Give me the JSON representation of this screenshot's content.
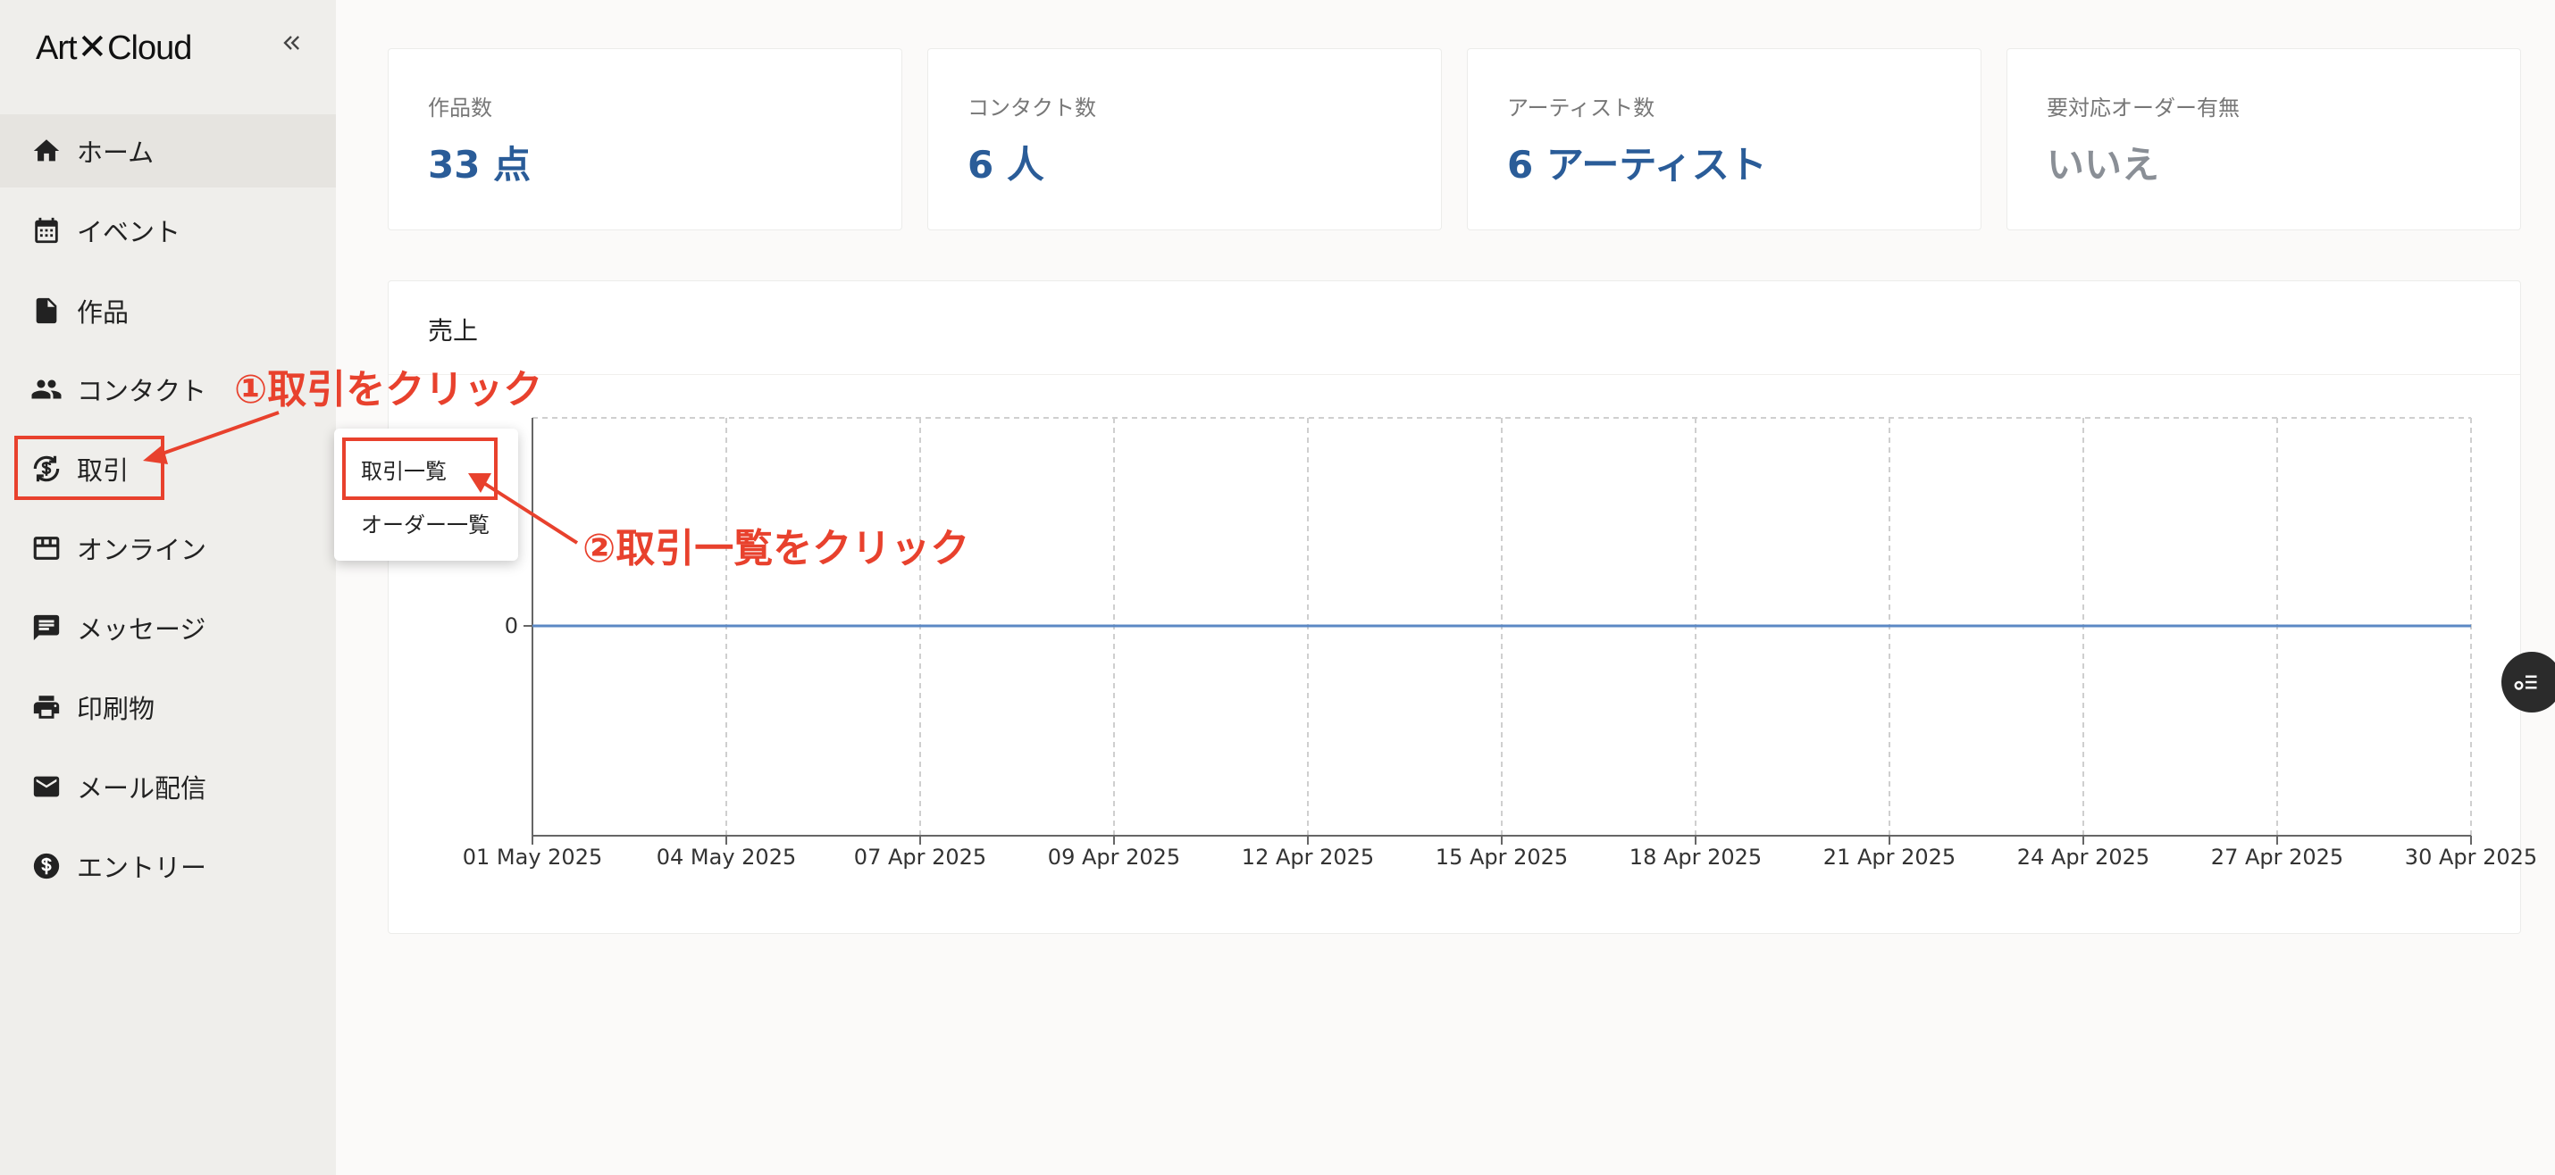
{
  "app": {
    "logo_left": "Art",
    "logo_x": "✕",
    "logo_right": "Cloud"
  },
  "sidebar": {
    "items": [
      {
        "label": "ホーム",
        "icon": "home-icon",
        "active": true
      },
      {
        "label": "イベント",
        "icon": "calendar-icon"
      },
      {
        "label": "作品",
        "icon": "document-icon"
      },
      {
        "label": "コンタクト",
        "icon": "people-icon"
      },
      {
        "label": "取引",
        "icon": "currency-exchange-icon"
      },
      {
        "label": "オンライン",
        "icon": "store-icon"
      },
      {
        "label": "メッセージ",
        "icon": "message-icon"
      },
      {
        "label": "印刷物",
        "icon": "printer-icon"
      },
      {
        "label": "メール配信",
        "icon": "mail-icon"
      },
      {
        "label": "エントリー",
        "icon": "dollar-circle-icon"
      }
    ]
  },
  "stats": [
    {
      "label": "作品数",
      "value": "33 点"
    },
    {
      "label": "コンタクト数",
      "value": "6 人"
    },
    {
      "label": "アーティスト数",
      "value": "6 アーティスト"
    },
    {
      "label": "要対応オーダー有無",
      "value": "いいえ"
    }
  ],
  "sales": {
    "title": "売上"
  },
  "dropdown": {
    "items": [
      "取引一覧",
      "オーダー一覧"
    ]
  },
  "annotations": {
    "step1": "①取引をクリック",
    "step2": "②取引一覧をクリック",
    "color": "#e8412d"
  },
  "chart_data": {
    "type": "line",
    "title": "",
    "xlabel": "",
    "ylabel": "",
    "x": [
      "01 May 2025",
      "04 May 2025",
      "07 Apr 2025",
      "09 Apr 2025",
      "12 Apr 2025",
      "15 Apr 2025",
      "18 Apr 2025",
      "21 Apr 2025",
      "24 Apr 2025",
      "27 Apr 2025",
      "30 Apr 2025"
    ],
    "series": [
      {
        "values": [
          0,
          0,
          0,
          0,
          0,
          0,
          0,
          0,
          0,
          0,
          0
        ]
      }
    ],
    "y_ticks": [
      "0"
    ],
    "grid": true,
    "line_color": "#5b88c4"
  }
}
